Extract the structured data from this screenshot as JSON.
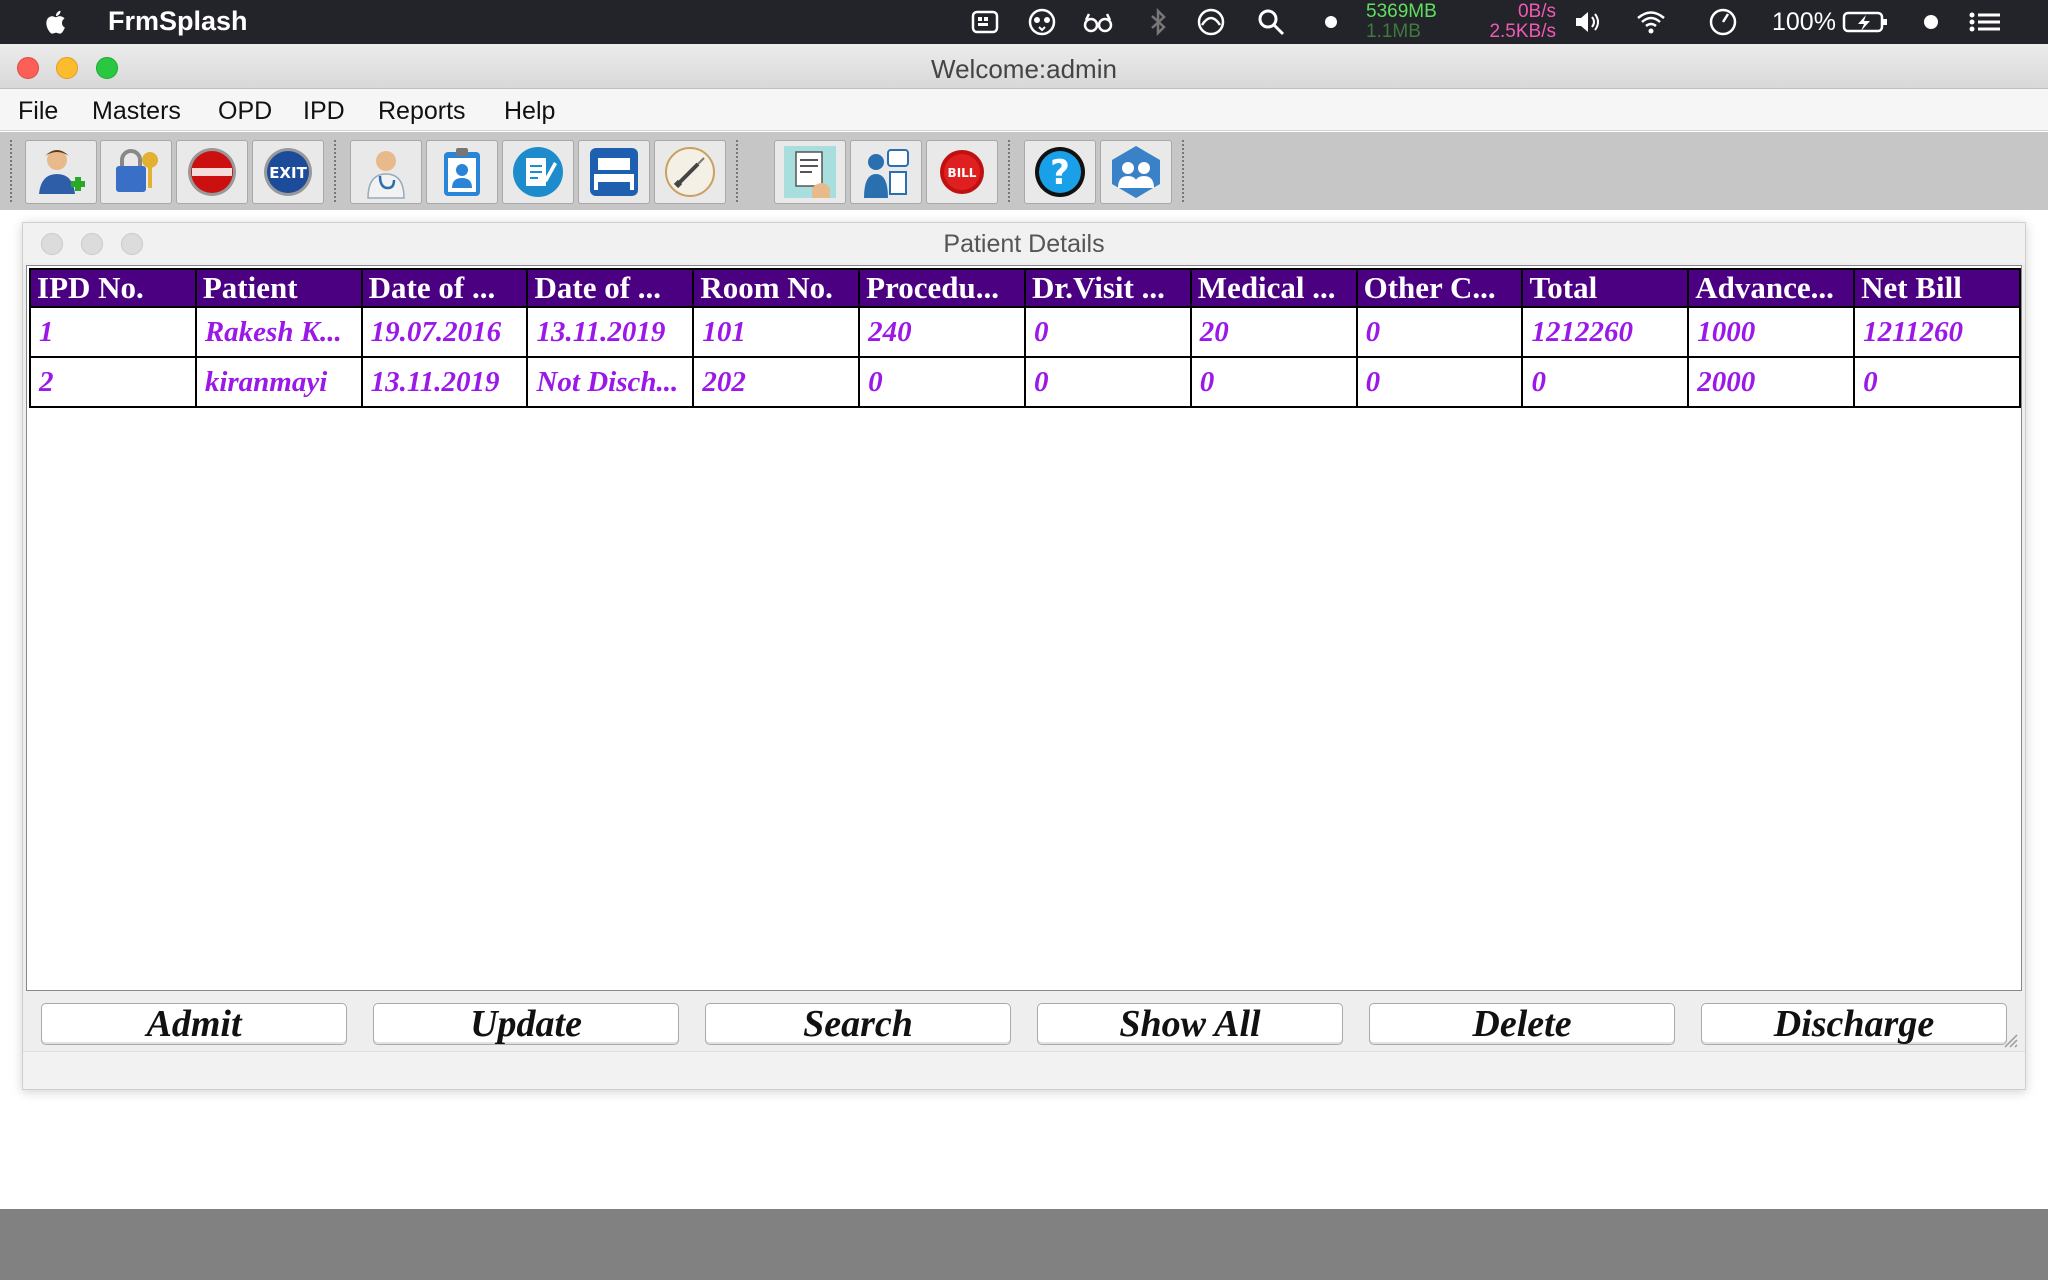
{
  "menubar": {
    "app_name": "FrmSplash",
    "memory": "5369MB",
    "memory_sub": "1.1MB",
    "net_up": "0B/s",
    "net_down": "2.5KB/s",
    "battery": "100%"
  },
  "window": {
    "title": "Welcome:admin"
  },
  "app_menu": [
    "File",
    "Masters",
    "OPD",
    "IPD",
    "Reports",
    "Help"
  ],
  "toolbar": {
    "group1": [
      "add-user-icon",
      "login-keys-icon",
      "logout-stop-icon",
      "exit-icon"
    ],
    "group2": [
      "doctor-icon",
      "clipboard-patient-icon",
      "document-edit-icon",
      "bed-hospital-icon",
      "syringe-icon"
    ],
    "group3": [
      "medical-report-icon",
      "consultation-icon",
      "bill-stop-icon"
    ],
    "group4": [
      "help-icon",
      "about-team-icon"
    ]
  },
  "patient_details": {
    "title": "Patient Details",
    "columns": [
      "IPD No.",
      "Patient",
      "Date of ...",
      "Date of ...",
      "Room No.",
      "Procedu...",
      "Dr.Visit ...",
      "Medical ...",
      "Other C...",
      "Total",
      "Advance...",
      "Net Bill"
    ],
    "rows": [
      [
        "1",
        "Rakesh K...",
        "19.07.2016",
        "13.11.2019",
        "101",
        "240",
        "0",
        "20",
        "0",
        "1212260",
        "1000",
        "1211260"
      ],
      [
        "2",
        "kiranmayi",
        "13.11.2019",
        "Not Disch...",
        "202",
        "0",
        "0",
        "0",
        "0",
        "0",
        "2000",
        "0"
      ]
    ],
    "buttons": {
      "admit": "Admit",
      "update": "Update",
      "search": "Search",
      "show_all": "Show All",
      "delete": "Delete",
      "discharge": "Discharge"
    }
  },
  "colors": {
    "header_bg": "#4b0082",
    "cell_text": "#9b18e8"
  }
}
